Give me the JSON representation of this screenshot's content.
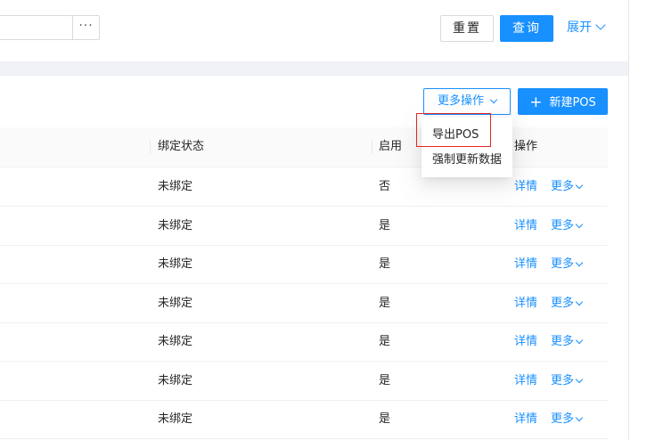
{
  "filter": {
    "reset_label": "重置",
    "query_label": "查询",
    "expand_label": "展开",
    "ellipsis": "···"
  },
  "toolbar": {
    "more_actions_label": "更多操作",
    "new_pos_label": "新建POS",
    "plus": "+"
  },
  "dropdown": {
    "items": [
      "导出POS",
      "强制更新数据"
    ]
  },
  "table": {
    "columns": [
      "绑定状态",
      "启用",
      "操作"
    ],
    "rows": [
      {
        "bind_status": "未绑定",
        "enabled": "否",
        "detail": "详情",
        "more": "更多"
      },
      {
        "bind_status": "未绑定",
        "enabled": "是",
        "detail": "详情",
        "more": "更多"
      },
      {
        "bind_status": "未绑定",
        "enabled": "是",
        "detail": "详情",
        "more": "更多"
      },
      {
        "bind_status": "未绑定",
        "enabled": "是",
        "detail": "详情",
        "more": "更多"
      },
      {
        "bind_status": "未绑定",
        "enabled": "是",
        "detail": "详情",
        "more": "更多"
      },
      {
        "bind_status": "未绑定",
        "enabled": "是",
        "detail": "详情",
        "more": "更多"
      },
      {
        "bind_status": "未绑定",
        "enabled": "是",
        "detail": "详情",
        "more": "更多"
      }
    ]
  },
  "colors": {
    "primary": "#1890ff",
    "highlight": "#e02424"
  }
}
